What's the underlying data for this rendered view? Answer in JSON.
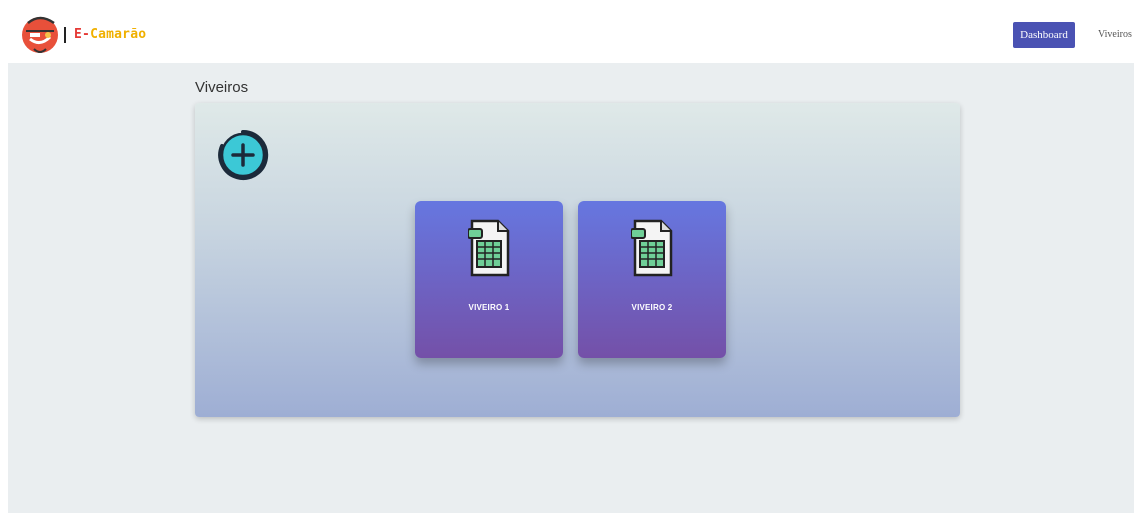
{
  "header": {
    "brand_prefix": "E-",
    "brand_suffix": "Camarão",
    "logo_icon": "shrimp-logo-icon",
    "nav": {
      "dashboard_label": "Dashboard",
      "viveiros_label": "Viveiros"
    },
    "colors": {
      "nav_button": "#4a52b3",
      "brand_red": "#e53935",
      "brand_yellow": "#f0b000"
    }
  },
  "main": {
    "title": "Viveiros",
    "add_icon": "add-circle-icon",
    "cards": [
      {
        "label": "VIVEIRO 1",
        "icon": "spreadsheet-icon"
      },
      {
        "label": "VIVEIRO 2",
        "icon": "spreadsheet-icon"
      }
    ],
    "colors": {
      "card_top": "#6677e0",
      "card_bottom": "#7450a8"
    }
  }
}
